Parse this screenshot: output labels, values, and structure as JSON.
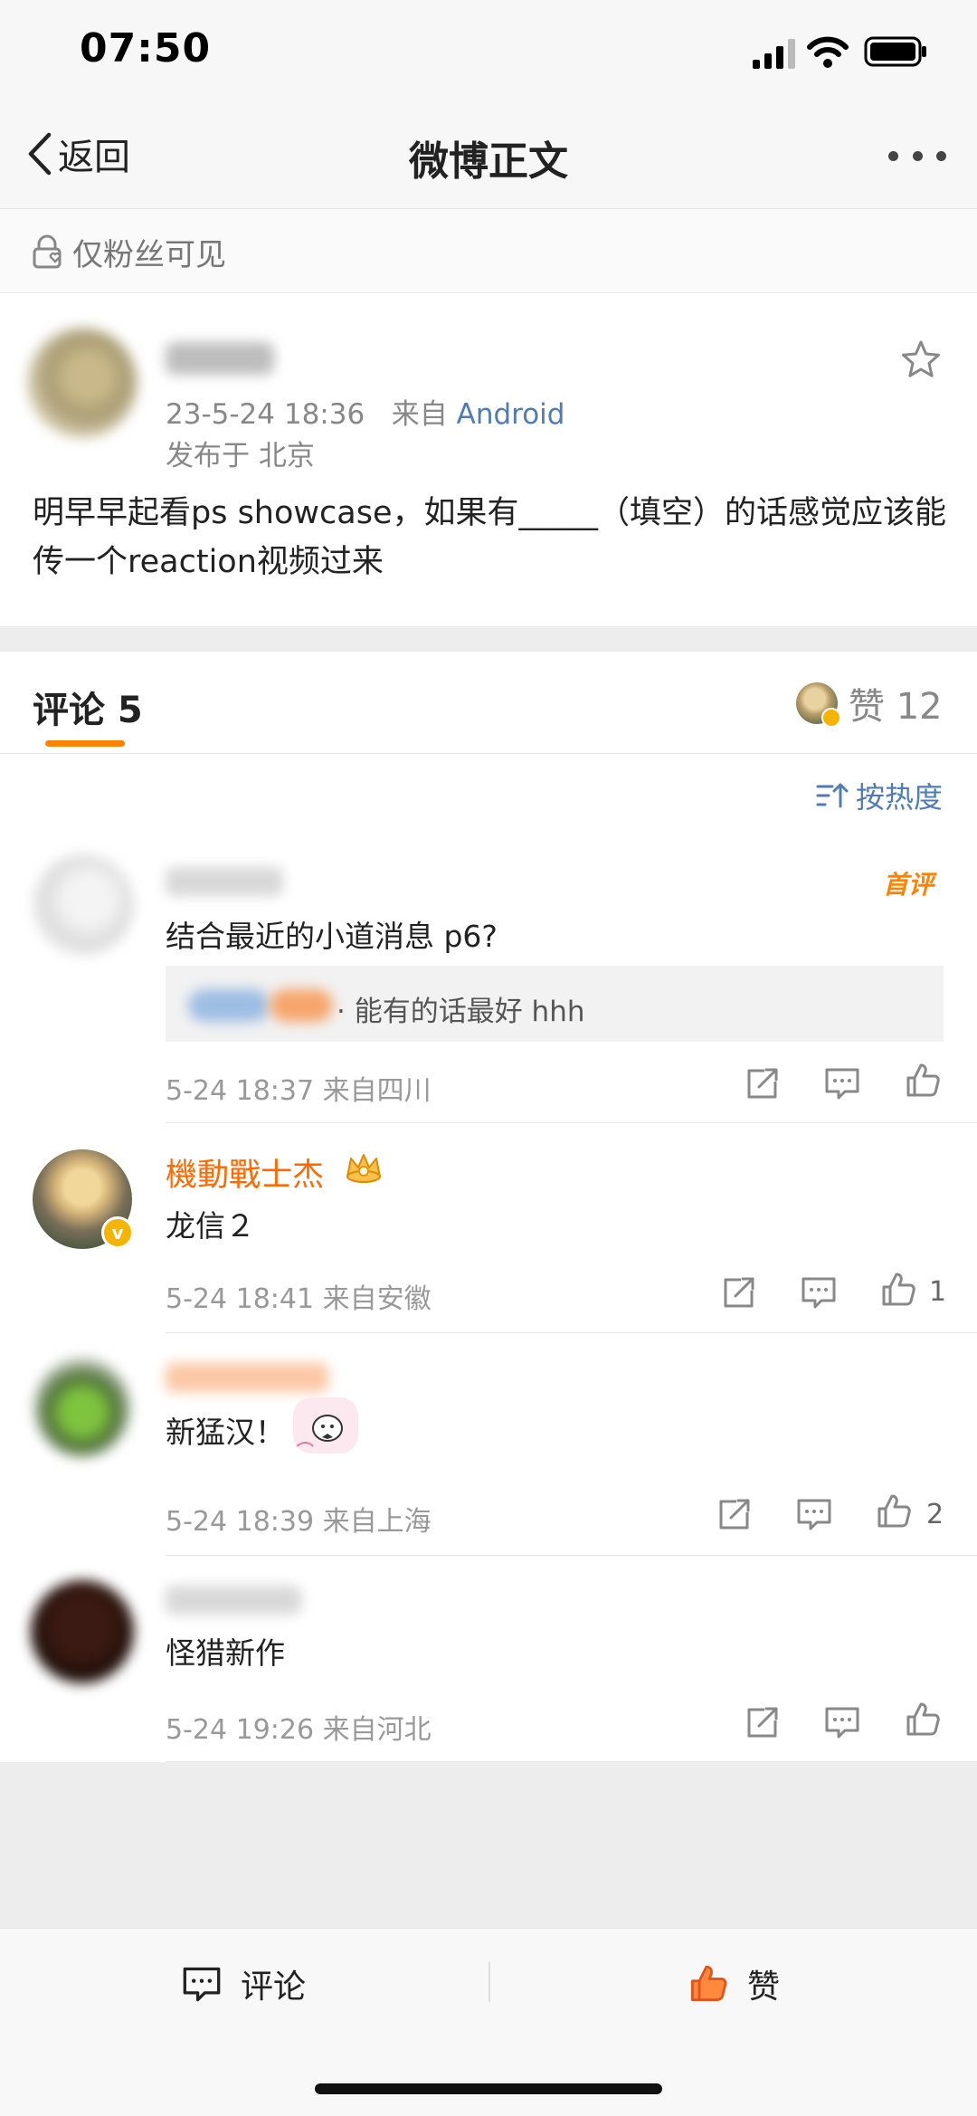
{
  "status_bar": {
    "time": "07:50"
  },
  "nav": {
    "back_label": "返回",
    "title": "微博正文"
  },
  "visibility": {
    "label": "仅粉丝可见"
  },
  "post": {
    "time": "23-5-24 18:36",
    "source_prefix": "来自",
    "source": "Android",
    "location": "发布于 北京",
    "text": "明早早起看ps showcase，如果有_____（填空）的话感觉应该能传一个reaction视频过来"
  },
  "comment_header": {
    "comments_label": "评论 5",
    "likes_label": "赞 12"
  },
  "sort": {
    "label": "按热度"
  },
  "comments": [
    {
      "text": "结合最近的小道消息 p6?",
      "badge": "首评",
      "reply": "· 能有的话最好 hhh",
      "time": "5-24 18:37  来自四川",
      "likes": ""
    },
    {
      "name": "機動戰士杰",
      "text": "龙信２",
      "time": "5-24 18:41  来自安徽",
      "likes": "1"
    },
    {
      "text": "新猛汉！",
      "time": "5-24 18:39  来自上海",
      "likes": "2"
    },
    {
      "text": "怪猎新作",
      "time": "5-24 19:26  来自河北",
      "likes": ""
    }
  ],
  "bottom_bar": {
    "comment_label": "评论",
    "like_label": "赞"
  },
  "colors": {
    "accent": "#ff8200",
    "link": "#4f7db3",
    "orange_name": "#ff6a00"
  },
  "icons": [
    "back-chevron-icon",
    "more-dots-icon",
    "lock-heart-icon",
    "star-icon",
    "sort-icon",
    "share-icon",
    "comment-icon",
    "like-icon",
    "crown-icon",
    "verified-icon"
  ]
}
